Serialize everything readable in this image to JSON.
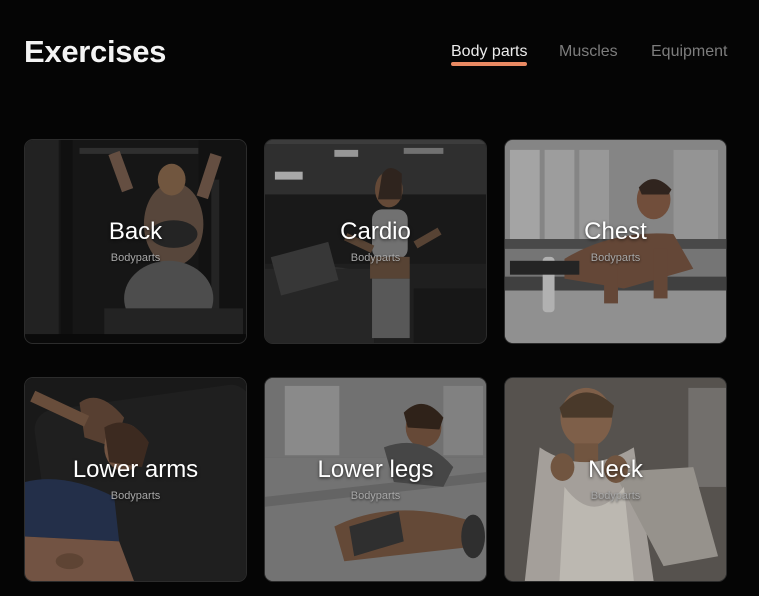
{
  "header": {
    "title": "Exercises"
  },
  "tabs": [
    {
      "label": "Body parts",
      "active": true
    },
    {
      "label": "Muscles",
      "active": false
    },
    {
      "label": "Equipment",
      "active": false
    }
  ],
  "accent_color": "#ea8a63",
  "cards": [
    {
      "title": "Back",
      "subtitle": "Bodyparts"
    },
    {
      "title": "Cardio",
      "subtitle": "Bodyparts"
    },
    {
      "title": "Chest",
      "subtitle": "Bodyparts"
    },
    {
      "title": "Lower arms",
      "subtitle": "Bodyparts"
    },
    {
      "title": "Lower legs",
      "subtitle": "Bodyparts"
    },
    {
      "title": "Neck",
      "subtitle": "Bodyparts"
    }
  ]
}
